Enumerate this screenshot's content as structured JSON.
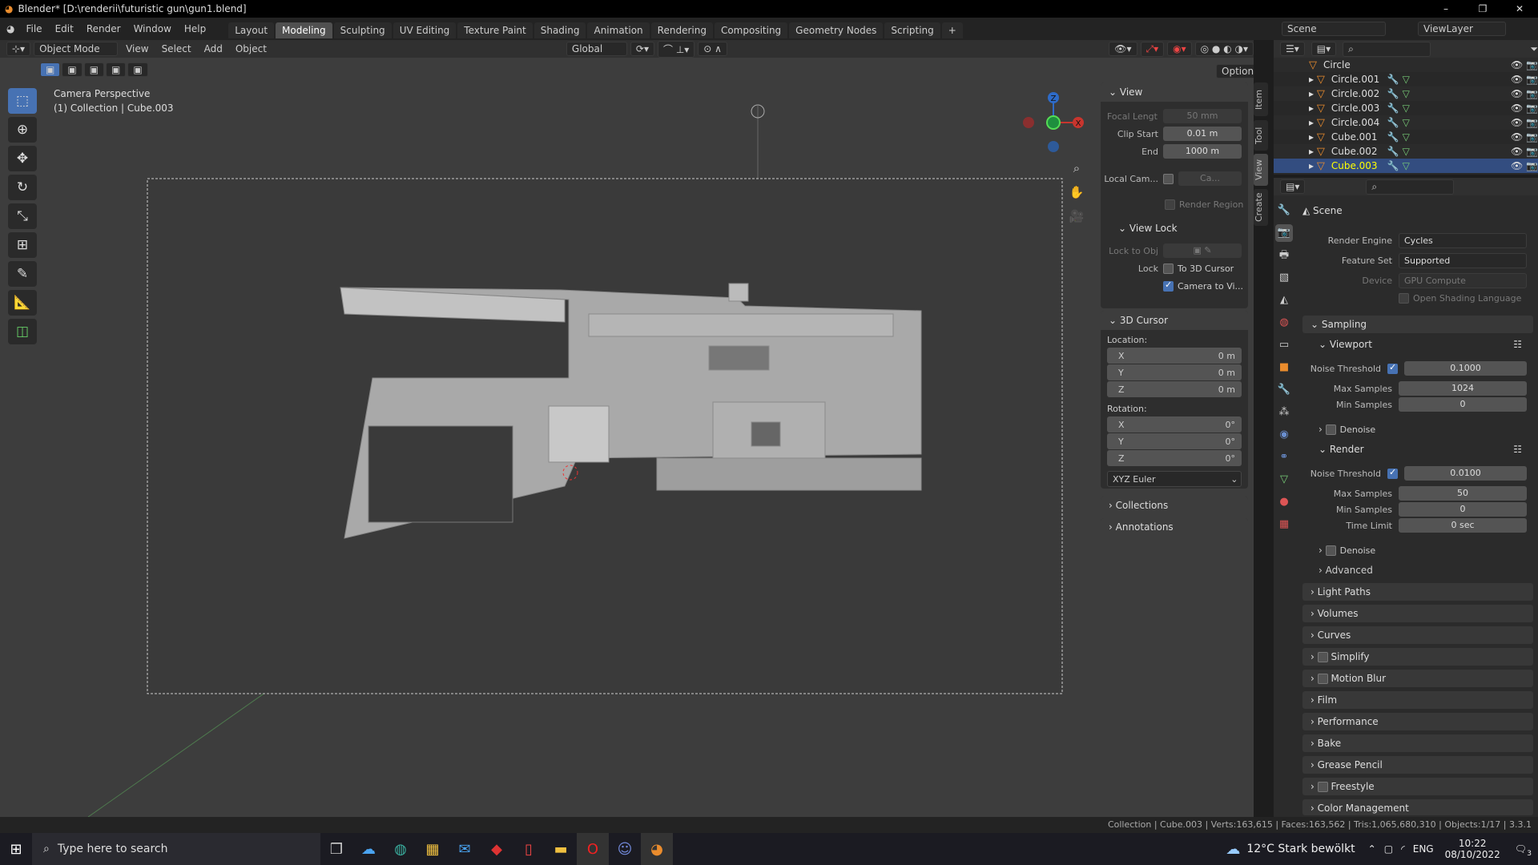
{
  "window": {
    "title": "Blender* [D:\\renderii\\futuristic gun\\gun1.blend]",
    "minimize": "–",
    "restore": "❐",
    "close": "✕"
  },
  "menu": [
    "File",
    "Edit",
    "Render",
    "Window",
    "Help"
  ],
  "workspaces": [
    "Layout",
    "Modeling",
    "Sculpting",
    "UV Editing",
    "Texture Paint",
    "Shading",
    "Animation",
    "Rendering",
    "Compositing",
    "Geometry Nodes",
    "Scripting",
    "+"
  ],
  "active_workspace": "Modeling",
  "scene": {
    "scene_label": "Scene",
    "viewlayer_label": "ViewLayer"
  },
  "header": {
    "mode": "Object Mode",
    "menus": [
      "View",
      "Select",
      "Add",
      "Object"
    ],
    "transform": "Global",
    "options": "Options"
  },
  "viewport": {
    "camera_label": "Camera Perspective",
    "collection_label": "(1) Collection | Cube.003",
    "gizmo": {
      "x": "X",
      "y": "Y",
      "z": "Z"
    }
  },
  "npanel": {
    "tabs": [
      "Item",
      "Tool",
      "View",
      "Create"
    ],
    "view": {
      "title": "View",
      "focal_label": "Focal Lengt",
      "focal": "50 mm",
      "clip_start_label": "Clip Start",
      "clip_start": "0.01 m",
      "end_label": "End",
      "end": "1000 m",
      "local_cam_label": "Local Cam...",
      "local_cam_value": "Ca...",
      "render_region": "Render Region",
      "view_lock": "View Lock",
      "lock_to_obj": "Lock to Obj",
      "lock": "Lock",
      "to_3d_cursor": "To 3D Cursor",
      "camera_to_view": "Camera to Vi..."
    },
    "cursor": {
      "title": "3D Cursor",
      "location": "Location:",
      "loc": [
        {
          "axis": "X",
          "value": "0 m"
        },
        {
          "axis": "Y",
          "value": "0 m"
        },
        {
          "axis": "Z",
          "value": "0 m"
        }
      ],
      "rotation": "Rotation:",
      "rot": [
        {
          "axis": "X",
          "value": "0°"
        },
        {
          "axis": "Y",
          "value": "0°"
        },
        {
          "axis": "Z",
          "value": "0°"
        }
      ],
      "mode": "XYZ Euler"
    },
    "collections": "Collections",
    "annotations": "Annotations"
  },
  "outliner": {
    "items": [
      "Circle",
      "Circle.001",
      "Circle.002",
      "Circle.003",
      "Circle.004",
      "Cube.001",
      "Cube.002",
      "Cube.003"
    ]
  },
  "properties": {
    "scene": "Scene",
    "render_engine_label": "Render Engine",
    "render_engine": "Cycles",
    "feature_set_label": "Feature Set",
    "feature_set": "Supported",
    "device_label": "Device",
    "device": "GPU Compute",
    "osl": "Open Shading Language",
    "sampling": "Sampling",
    "viewport": "Viewport",
    "noise_threshold_label": "Noise Threshold",
    "vp_noise": "0.1000",
    "max_samples_label": "Max Samples",
    "vp_max": "1024",
    "min_samples_label": "Min Samples",
    "vp_min": "0",
    "denoise": "Denoise",
    "render": "Render",
    "r_noise": "0.0100",
    "r_max": "50",
    "r_min": "0",
    "time_limit_label": "Time Limit",
    "time_limit": "0 sec",
    "advanced": "Advanced",
    "sections": [
      "Light Paths",
      "Volumes",
      "Curves",
      "Simplify",
      "Motion Blur",
      "Film",
      "Performance",
      "Bake",
      "Grease Pencil",
      "Freestyle",
      "Color Management"
    ]
  },
  "status": "Collection | Cube.003 | Verts:163,615 | Faces:163,562 | Tris:1,065,680,310 | Objects:1/17 | 3.3.1",
  "taskbar": {
    "search": "Type here to search",
    "weather": "12°C  Stark bewölkt",
    "lang": "ENG",
    "time": "10:22",
    "date": "08/10/2022",
    "notifications": "3"
  }
}
